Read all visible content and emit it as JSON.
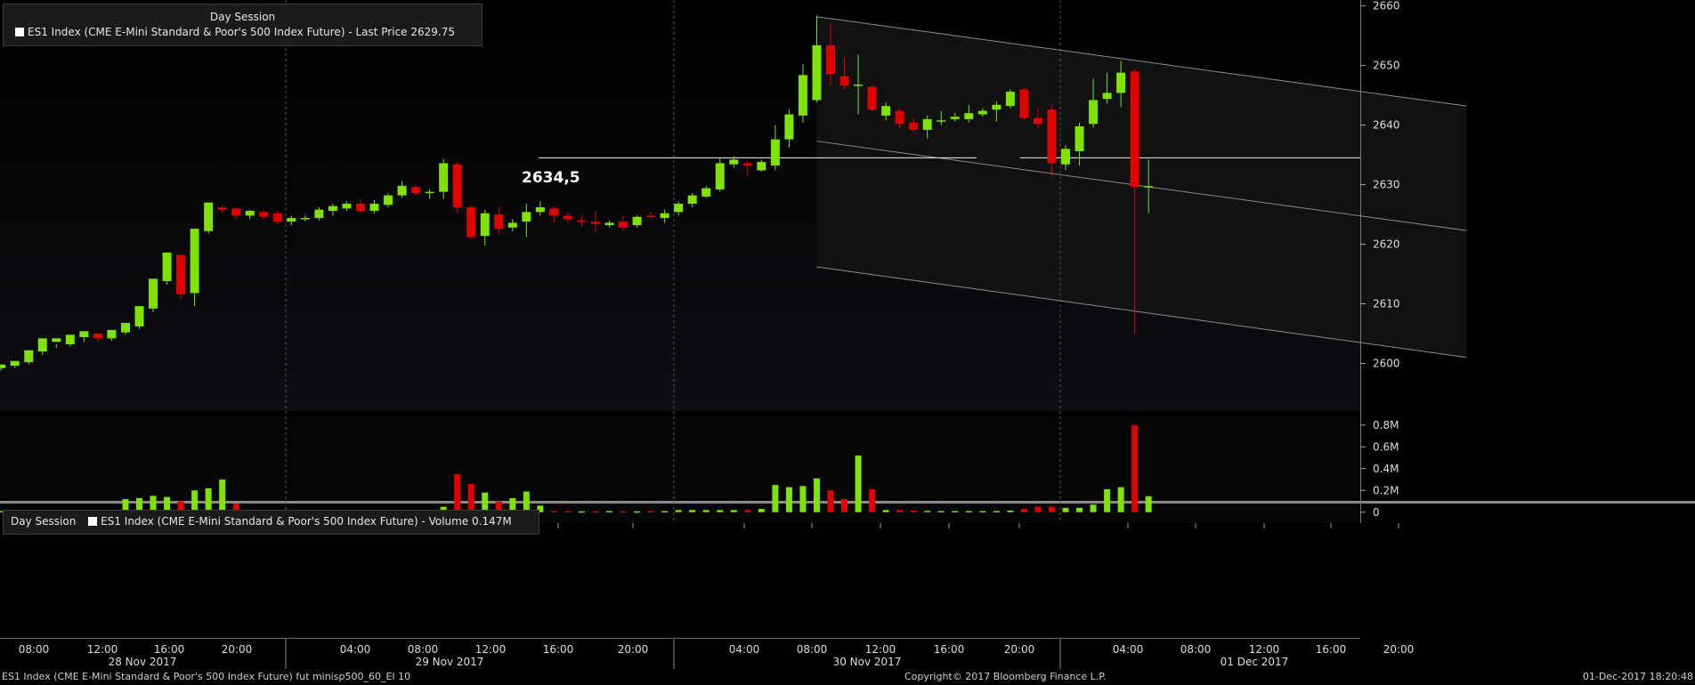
{
  "legend_top": {
    "session": "Day Session",
    "label": "ES1 Index (CME E-Mini Standard & Poor's 500 Index Future) - Last Price 2629.75"
  },
  "legend_volume": {
    "session": "Day Session",
    "label": "ES1 Index (CME E-Mini Standard & Poor's 500 Index Future) - Volume 0.147M"
  },
  "annotation": {
    "text": "2634,5",
    "level": 2634.5
  },
  "footer": {
    "left": "ES1 Index (CME E-Mini Standard & Poor's 500 Index Future) fut minisp500_60_EI 10",
    "center": "Copyright© 2017 Bloomberg Finance L.P.",
    "right": "01-Dec-2017 18:20:48"
  },
  "colors": {
    "up": "#7fe200",
    "down": "#e00000",
    "line": "#d9d9d9",
    "channel": "#8c8c8c",
    "text": "#dddddd"
  },
  "chart_data": [
    {
      "type": "candlestick",
      "y_axis_side": "right",
      "ylim": [
        2592,
        2661
      ],
      "yticks": [
        2600,
        2610,
        2620,
        2630,
        2640,
        2650,
        2660
      ],
      "x_time_labels": [
        "08:00",
        "12:00",
        "16:00",
        "20:00",
        "04:00",
        "08:00",
        "12:00",
        "16:00",
        "20:00",
        "04:00",
        "08:00",
        "12:00",
        "16:00",
        "20:00",
        "04:00",
        "08:00",
        "12:00",
        "16:00",
        "20:00"
      ],
      "x_date_labels": [
        "28 Nov 2017",
        "29 Nov 2017",
        "30 Nov 2017",
        "01 Dec 2017"
      ],
      "bars": [
        [
          2599.2,
          2599.8,
          2598.8,
          2599.6
        ],
        [
          2599.6,
          2600.4,
          2599.2,
          2600.2
        ],
        [
          2600.2,
          2602.2,
          2599.8,
          2602.0
        ],
        [
          2602.0,
          2604.2,
          2601.4,
          2603.8
        ],
        [
          2603.6,
          2604.2,
          2602.6,
          2603.2
        ],
        [
          2603.2,
          2604.8,
          2602.8,
          2604.4
        ],
        [
          2604.4,
          2605.4,
          2603.6,
          2605.0
        ],
        [
          2605.0,
          2604.2,
          2603.6,
          2604.6
        ],
        [
          2604.2,
          2605.6,
          2603.8,
          2605.2
        ],
        [
          2605.2,
          2606.8,
          2604.8,
          2606.2
        ],
        [
          2606.2,
          2609.6,
          2605.8,
          2609.2
        ],
        [
          2609.2,
          2614.2,
          2608.6,
          2613.8
        ],
        [
          2613.8,
          2618.6,
          2613.2,
          2618.2
        ],
        [
          2618.2,
          2611.6,
          2610.8,
          2611.8
        ],
        [
          2611.8,
          2622.6,
          2609.6,
          2622.2
        ],
        [
          2622.2,
          2627.0,
          2621.8,
          2626.6
        ],
        [
          2626.2,
          2625.8,
          2625.2,
          2626.6
        ],
        [
          2626.0,
          2624.8,
          2624.2,
          2626.2
        ],
        [
          2624.8,
          2625.6,
          2624.2,
          2625.8
        ],
        [
          2625.4,
          2624.6,
          2624.2,
          2625.8
        ],
        [
          2625.2,
          2623.8,
          2623.4,
          2625.6
        ],
        [
          2623.8,
          2624.4,
          2623.2,
          2624.8
        ],
        [
          2624.2,
          2624.4,
          2623.8,
          2624.8
        ],
        [
          2624.4,
          2625.8,
          2624.0,
          2626.2
        ],
        [
          2625.6,
          2626.4,
          2624.8,
          2626.8
        ],
        [
          2626.0,
          2626.8,
          2625.6,
          2627.2
        ],
        [
          2626.8,
          2625.6,
          2625.2,
          2627.6
        ],
        [
          2625.6,
          2626.8,
          2625.2,
          2627.4
        ],
        [
          2626.6,
          2628.2,
          2626.2,
          2628.6
        ],
        [
          2628.2,
          2629.8,
          2627.8,
          2630.6
        ],
        [
          2629.6,
          2628.6,
          2628.2,
          2630.2
        ],
        [
          2628.6,
          2628.8,
          2627.6,
          2629.2
        ],
        [
          2628.8,
          2633.6,
          2627.6,
          2634.3
        ],
        [
          2633.4,
          2626.2,
          2625.2,
          2633.8
        ],
        [
          2626.2,
          2621.2,
          2620.8,
          2626.6
        ],
        [
          2621.4,
          2625.2,
          2619.8,
          2625.8
        ],
        [
          2625.0,
          2622.6,
          2621.8,
          2626.2
        ],
        [
          2622.8,
          2623.6,
          2622.2,
          2624.2
        ],
        [
          2623.8,
          2625.4,
          2621.2,
          2626.8
        ],
        [
          2625.4,
          2626.2,
          2624.8,
          2627.2
        ],
        [
          2626.0,
          2624.8,
          2623.6,
          2626.4
        ],
        [
          2624.8,
          2624.2,
          2623.6,
          2625.4
        ],
        [
          2624.0,
          2623.8,
          2623.0,
          2624.8
        ],
        [
          2623.8,
          2623.4,
          2622.0,
          2625.6
        ],
        [
          2623.2,
          2623.6,
          2622.8,
          2624.0
        ],
        [
          2623.8,
          2622.8,
          2622.2,
          2624.8
        ],
        [
          2623.2,
          2624.6,
          2622.8,
          2624.8
        ],
        [
          2624.8,
          2624.6,
          2624.2,
          2625.4
        ],
        [
          2624.4,
          2625.2,
          2623.6,
          2625.8
        ],
        [
          2625.4,
          2626.8,
          2624.8,
          2627.2
        ],
        [
          2626.8,
          2628.2,
          2626.2,
          2628.6
        ],
        [
          2628.0,
          2629.4,
          2627.8,
          2629.8
        ],
        [
          2629.2,
          2633.6,
          2628.8,
          2634.4
        ],
        [
          2633.4,
          2634.2,
          2632.8,
          2634.8
        ],
        [
          2633.6,
          2633.2,
          2631.4,
          2634.0
        ],
        [
          2632.4,
          2633.8,
          2632.2,
          2634.2
        ],
        [
          2633.2,
          2637.6,
          2632.4,
          2640.0
        ],
        [
          2637.6,
          2641.8,
          2636.2,
          2642.6
        ],
        [
          2641.6,
          2648.4,
          2640.4,
          2650.2
        ],
        [
          2644.2,
          2653.4,
          2643.8,
          2658.4
        ],
        [
          2653.4,
          2648.6,
          2646.6,
          2657.0
        ],
        [
          2648.2,
          2646.6,
          2646.0,
          2651.4
        ],
        [
          2646.6,
          2646.8,
          2641.8,
          2651.8
        ],
        [
          2646.4,
          2642.6,
          2642.2,
          2646.8
        ],
        [
          2641.6,
          2643.2,
          2640.8,
          2643.8
        ],
        [
          2642.4,
          2640.2,
          2639.4,
          2642.8
        ],
        [
          2640.4,
          2639.2,
          2638.8,
          2641.4
        ],
        [
          2639.2,
          2641.0,
          2637.8,
          2641.6
        ],
        [
          2640.6,
          2640.8,
          2640.0,
          2642.4
        ],
        [
          2641.0,
          2641.4,
          2640.6,
          2642.0
        ],
        [
          2641.0,
          2642.0,
          2640.4,
          2643.4
        ],
        [
          2641.8,
          2642.4,
          2641.4,
          2642.8
        ],
        [
          2642.6,
          2643.4,
          2640.6,
          2644.0
        ],
        [
          2643.2,
          2645.6,
          2642.8,
          2646.0
        ],
        [
          2646.0,
          2641.2,
          2640.8,
          2646.4
        ],
        [
          2641.2,
          2640.2,
          2639.4,
          2643.0
        ],
        [
          2642.6,
          2633.6,
          2631.4,
          2643.4
        ],
        [
          2633.4,
          2636.0,
          2632.4,
          2636.6
        ],
        [
          2635.6,
          2639.8,
          2633.2,
          2640.4
        ],
        [
          2640.2,
          2644.2,
          2639.6,
          2647.8
        ],
        [
          2644.4,
          2645.4,
          2643.6,
          2648.8
        ],
        [
          2645.4,
          2648.8,
          2643.0,
          2650.8
        ],
        [
          2649.0,
          2629.6,
          2605.0,
          2649.4
        ],
        [
          2629.6,
          2629.75,
          2625.2,
          2634.2
        ]
      ],
      "annotation_line": {
        "label": "2634,5",
        "value": 2634.5
      },
      "channel_lines": [
        {
          "from": {
            "bar": 59,
            "value": 2658.2
          },
          "to": {
            "bar": 106,
            "value": 2643.2
          }
        },
        {
          "from": {
            "bar": 59,
            "value": 2637.3
          },
          "to": {
            "bar": 106,
            "value": 2622.3
          }
        },
        {
          "from": {
            "bar": 59,
            "value": 2616.2
          },
          "to": {
            "bar": 106,
            "value": 2601.0
          }
        }
      ]
    },
    {
      "type": "bar",
      "y_axis_side": "right",
      "ylim": [
        -0.1,
        0.88
      ],
      "yticks": [
        0,
        0.2,
        0.4,
        0.6,
        0.8
      ],
      "ytick_labels": [
        "0",
        "0.2M",
        "0.4M",
        "0.6M",
        "0.8M"
      ],
      "values": [
        0.01,
        0.01,
        0.01,
        0.015,
        0.015,
        0.01,
        0.01,
        0.01,
        0.008,
        0.12,
        0.13,
        0.15,
        0.14,
        0.1,
        0.2,
        0.22,
        0.3,
        0.08,
        0.01,
        0.01,
        0.008,
        0.008,
        0.008,
        0.008,
        0.008,
        0.008,
        0.01,
        0.01,
        0.012,
        0.012,
        0.015,
        0.02,
        0.05,
        0.35,
        0.26,
        0.18,
        0.1,
        0.13,
        0.19,
        0.06,
        0.01,
        0.01,
        0.008,
        0.008,
        0.01,
        0.008,
        0.008,
        0.01,
        0.01,
        0.02,
        0.02,
        0.02,
        0.02,
        0.02,
        0.02,
        0.03,
        0.25,
        0.23,
        0.24,
        0.31,
        0.2,
        0.12,
        0.52,
        0.21,
        0.02,
        0.02,
        0.015,
        0.012,
        0.01,
        0.01,
        0.01,
        0.01,
        0.01,
        0.015,
        0.03,
        0.05,
        0.05,
        0.04,
        0.04,
        0.07,
        0.21,
        0.23,
        0.8,
        0.147
      ],
      "up_down": [
        1,
        1,
        1,
        1,
        1,
        1,
        1,
        1,
        1,
        1,
        1,
        1,
        1,
        0,
        1,
        1,
        1,
        0,
        0,
        0,
        0,
        0,
        1,
        1,
        1,
        1,
        0,
        1,
        1,
        1,
        0,
        1,
        1,
        0,
        0,
        1,
        0,
        1,
        1,
        1,
        0,
        0,
        1,
        0,
        1,
        0,
        1,
        0,
        1,
        1,
        1,
        1,
        1,
        1,
        0,
        1,
        1,
        1,
        1,
        1,
        0,
        0,
        1,
        0,
        1,
        0,
        0,
        1,
        1,
        1,
        1,
        1,
        1,
        1,
        0,
        0,
        0,
        1,
        1,
        1,
        1,
        1,
        0,
        1
      ]
    }
  ]
}
